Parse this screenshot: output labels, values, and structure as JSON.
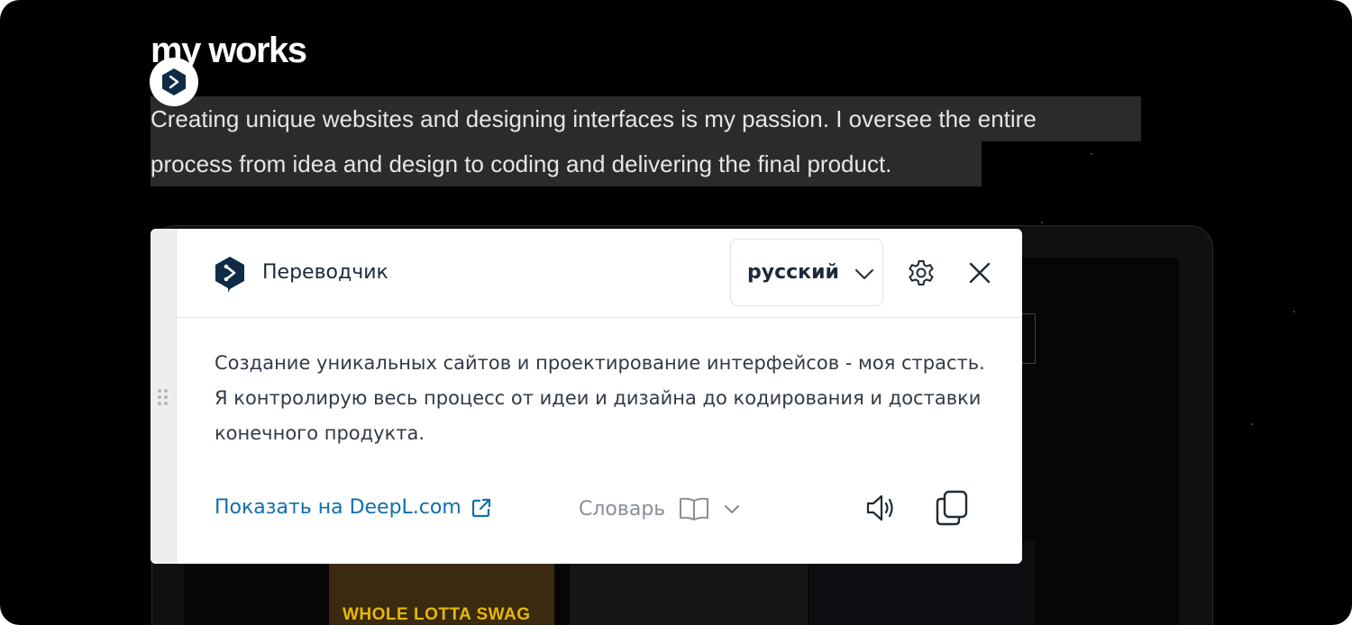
{
  "page": {
    "title": "my works",
    "selected_text_line1": "Creating unique websites and designing interfaces is my passion. I oversee the entire",
    "selected_text_line2": "process from idea and design to coding and delivering the final product."
  },
  "background": {
    "poster_caption": "WHOLE LOTTA SWAG"
  },
  "translator": {
    "title": "Переводчик",
    "target_language": "русский",
    "translation": "Создание уникальных сайтов и проектирование интерфейсов - моя страсть. Я контролирую весь процесс от идеи и дизайна до кодирования и доставки конечного продукта.",
    "open_link_label": "Показать на DeepL.com",
    "dictionary_label": "Словарь",
    "icons": {
      "logo": "deepl-logo-icon",
      "chevron": "chevron-down-icon",
      "settings": "gear-icon",
      "close": "close-icon",
      "external": "external-link-icon",
      "dictionary": "book-icon",
      "speaker": "speaker-icon",
      "copy": "copy-icon",
      "drag": "drag-handle-icon"
    },
    "colors": {
      "brand": "#0f2b46",
      "link": "#0f6fae",
      "muted": "#8a8f96"
    }
  }
}
